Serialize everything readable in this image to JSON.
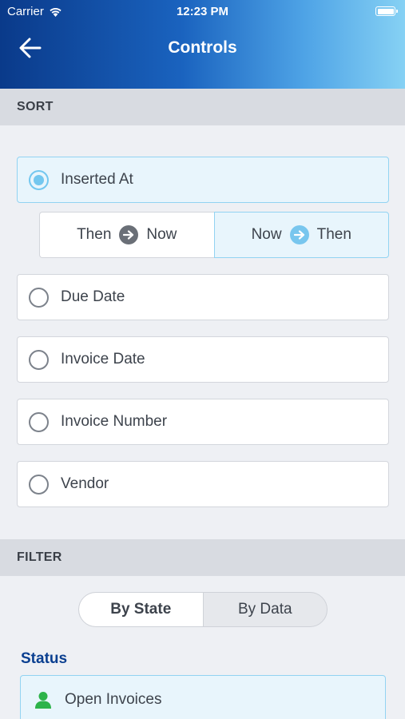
{
  "status_bar": {
    "carrier": "Carrier",
    "time": "12:23 PM"
  },
  "header": {
    "title": "Controls",
    "back_icon": "arrow-left-icon"
  },
  "sort": {
    "heading": "SORT",
    "selected": "Inserted At",
    "options": [
      "Inserted At",
      "Due Date",
      "Invoice Date",
      "Invoice Number",
      "Vendor"
    ],
    "order": {
      "selected": "Now to Then",
      "left": {
        "from": "Then",
        "to": "Now"
      },
      "right": {
        "from": "Now",
        "to": "Then"
      }
    }
  },
  "filter": {
    "heading": "FILTER",
    "tabs": [
      "By State",
      "By Data"
    ],
    "active_tab": "By State",
    "status_label": "Status",
    "status_items": [
      "Open Invoices"
    ]
  },
  "colors": {
    "accent": "#73c7ef",
    "header_start": "#0a3a8a",
    "header_end": "#86d1f4",
    "status_label": "#0a3f90",
    "user_icon": "#2db34a"
  }
}
